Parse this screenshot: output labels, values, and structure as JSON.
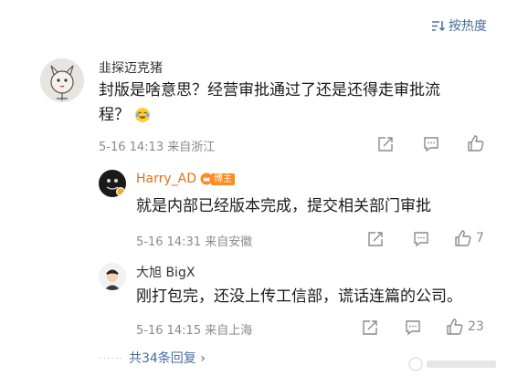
{
  "sort_label": "按热度",
  "comment": {
    "username": "韭探迈克猪",
    "text_line1": "封版是啥意思？经营审批通过了还是还得走审批流",
    "text_line2": "程？",
    "time": "5-16 14:13",
    "location": "来自浙江"
  },
  "replies": [
    {
      "username": "Harry_AD",
      "badge": "博主",
      "text": "就是内部已经版本完成，提交相关部门审批",
      "time": "5-16 14:31",
      "location": "来自安徽",
      "likes": "7"
    },
    {
      "username": "大旭 BigX",
      "text": "刚打包完，还没上传工信部，谎话连篇的公司。",
      "time": "5-16 14:15",
      "location": "来自上海",
      "likes": "23"
    }
  ],
  "more_replies": "共34条回复 ›",
  "colors": {
    "link": "#4a6c9e",
    "meta": "#8a8a8a",
    "badge": "#ff8a1f"
  }
}
